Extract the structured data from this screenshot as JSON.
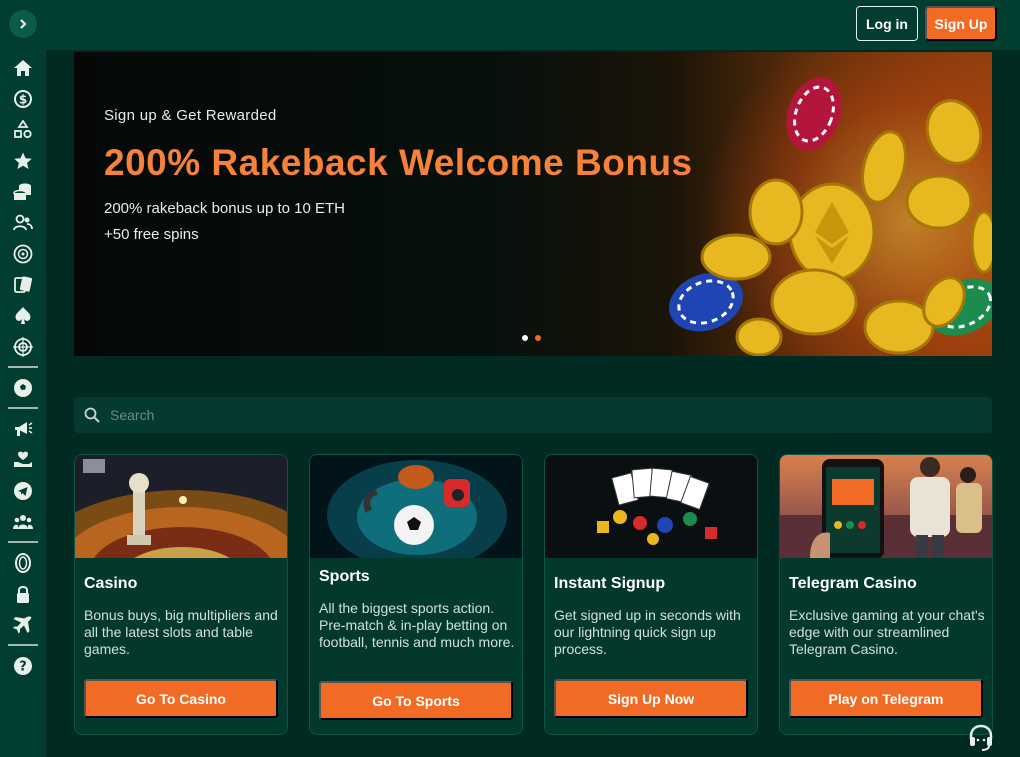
{
  "topbar": {
    "login_label": "Log in",
    "signup_label": "Sign Up"
  },
  "sidebar": {
    "icons": [
      "home-icon",
      "dollar-icon",
      "shapes-icon",
      "star-icon",
      "coins-stack-icon",
      "users-icon",
      "roulette-icon",
      "cards-icon",
      "spade-icon",
      "target-icon",
      "soccer-ball-icon",
      "megaphone-icon",
      "heart-hand-icon",
      "telegram-icon",
      "group-icon",
      "coin-icon",
      "lock-icon",
      "plane-icon",
      "help-icon"
    ]
  },
  "banner": {
    "kicker": "Sign up & Get Rewarded",
    "title": "200% Rakeback Welcome Bonus",
    "line1": "200% rakeback bonus up to 10 ETH",
    "line2": "+50 free spins",
    "slides": 2,
    "active_slide": 2
  },
  "search": {
    "placeholder": "Search"
  },
  "cards": [
    {
      "title": "Casino",
      "desc": "Bonus buys, big multipliers and all the latest slots and table games.",
      "button": "Go To Casino"
    },
    {
      "title": "Sports",
      "desc": "All the biggest sports action. Pre-match & in-play betting on football, tennis and much more.",
      "button": "Go To Sports"
    },
    {
      "title": "Instant Signup",
      "desc": "Get signed up in seconds with our lightning quick sign up process.",
      "button": "Sign Up Now"
    },
    {
      "title": "Telegram Casino",
      "desc": "Exclusive gaming at your chat's edge with our streamlined Telegram Casino.",
      "button": "Play on Telegram"
    }
  ],
  "colors": {
    "accent": "#f26b24",
    "background": "#012a22",
    "panel": "#023d31"
  }
}
